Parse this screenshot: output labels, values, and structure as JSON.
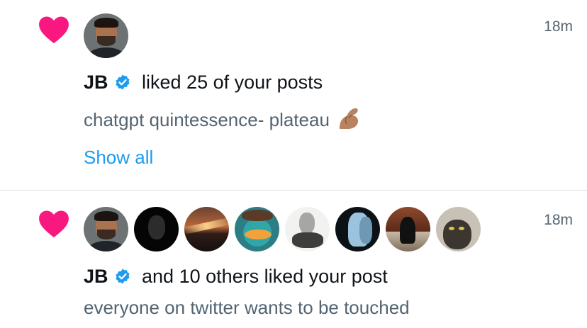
{
  "notifications": [
    {
      "type": "like",
      "time": "18m",
      "user": "JB",
      "action": " liked 25 of your posts",
      "snippet": "chatgpt quintessence- plateau",
      "snippet_emoji": "pinched-fingers",
      "link": "Show all",
      "avatars": [
        "avatar-jb"
      ]
    },
    {
      "type": "like",
      "time": "18m",
      "user": "JB",
      "action": " and 10 others liked your post",
      "snippet": "everyone on twitter wants to be touched",
      "avatars": [
        "avatar-jb",
        "avatar-mask",
        "avatar-sunset",
        "avatar-perry",
        "avatar-statue",
        "avatar-robot",
        "avatar-room",
        "avatar-cat"
      ]
    }
  ],
  "colors": {
    "heart": "#f91880",
    "verified": "#1d9bf0",
    "link": "#1d9bf0",
    "secondary_text": "#536471",
    "divider": "#dcdfe2"
  }
}
